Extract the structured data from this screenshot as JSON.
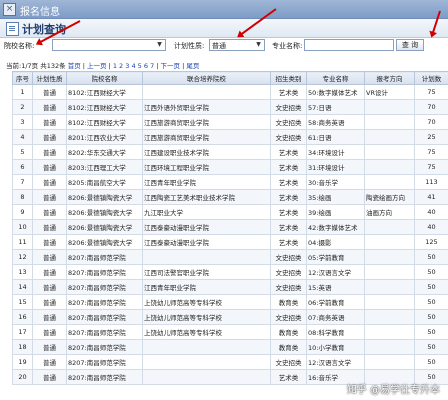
{
  "window": {
    "title": "报名信息",
    "close_glyph": "×"
  },
  "section": {
    "title": "计划查询"
  },
  "search": {
    "school_label": "院校名称:",
    "school_value": "",
    "plan_type_label": "计划性质:",
    "plan_type_value": "普通",
    "major_label": "专业名称:",
    "major_value": "",
    "query_button": "查 询"
  },
  "pager": {
    "summary": "当前:1/7页 共132条",
    "first": "首页",
    "prev": "上一页",
    "pages": "1 2 3 4 5 6 7",
    "next": "下一页",
    "last": "尾页"
  },
  "table": {
    "headers": [
      "序号",
      "计划性质",
      "院校名称",
      "联合培养院校",
      "招生类别",
      "专业名称",
      "报考方向",
      "计划数"
    ],
    "rows": [
      [
        "1",
        "普通",
        "8102:江西财经大学",
        "",
        "艺术类",
        "50:数字媒体艺术",
        "VR设计",
        "75"
      ],
      [
        "2",
        "普通",
        "8102:江西财经大学",
        "江西外语外贸职业学院",
        "文史招类",
        "57:日语",
        "",
        "70"
      ],
      [
        "3",
        "普通",
        "8102:江西财经大学",
        "江西旅游商贸职业学院",
        "文史招类",
        "58:商务英语",
        "",
        "70"
      ],
      [
        "4",
        "普通",
        "8201:江西农业大学",
        "江西旅游商贸职业学院",
        "文史招类",
        "61:日语",
        "",
        "25"
      ],
      [
        "5",
        "普通",
        "8202:华东交通大学",
        "江西建设职业技术学院",
        "艺术类",
        "34:环境设计",
        "",
        "75"
      ],
      [
        "6",
        "普通",
        "8203:江西理工大学",
        "江西环境工程职业学院",
        "艺术类",
        "31:环境设计",
        "",
        "75"
      ],
      [
        "7",
        "普通",
        "8205:南昌航空大学",
        "江西青年职业学院",
        "艺术类",
        "30:音乐学",
        "",
        "113"
      ],
      [
        "8",
        "普通",
        "8206:景德镇陶瓷大学",
        "江西陶瓷工艺美术职业技术学院",
        "艺术类",
        "35:绘画",
        "陶瓷绘画方向",
        "41"
      ],
      [
        "9",
        "普通",
        "8206:景德镇陶瓷大学",
        "九江职业大学",
        "艺术类",
        "39:绘画",
        "油画方向",
        "40"
      ],
      [
        "10",
        "普通",
        "8206:景德镇陶瓷大学",
        "江西泰豪动漫职业学院",
        "艺术类",
        "42:数字媒体艺术",
        "",
        "40"
      ],
      [
        "11",
        "普通",
        "8206:景德镇陶瓷大学",
        "江西泰豪动漫职业学院",
        "艺术类",
        "04:摄影",
        "",
        "125"
      ],
      [
        "12",
        "普通",
        "8207:南昌师范学院",
        "",
        "文史招类",
        "05:学前教育",
        "",
        "50"
      ],
      [
        "13",
        "普通",
        "8207:南昌师范学院",
        "江西司法警官职业学院",
        "文史招类",
        "12:汉语言文学",
        "",
        "50"
      ],
      [
        "14",
        "普通",
        "8207:南昌师范学院",
        "江西青年职业学院",
        "文史招类",
        "15:英语",
        "",
        "50"
      ],
      [
        "15",
        "普通",
        "8207:南昌师范学院",
        "上饶幼儿师范高等专科学校",
        "教育类",
        "06:学前教育",
        "",
        "50"
      ],
      [
        "16",
        "普通",
        "8207:南昌师范学院",
        "上饶幼儿师范高等专科学校",
        "文史招类",
        "07:商务英语",
        "",
        "50"
      ],
      [
        "17",
        "普通",
        "8207:南昌师范学院",
        "上饶幼儿师范高等专科学校",
        "教育类",
        "08:科学教育",
        "",
        "50"
      ],
      [
        "18",
        "普通",
        "8207:南昌师范学院",
        "",
        "教育类",
        "10:小学教育",
        "",
        "50"
      ],
      [
        "19",
        "普通",
        "8207:南昌师范学院",
        "",
        "文史招类",
        "12:汉语言文学",
        "",
        "50"
      ],
      [
        "20",
        "普通",
        "8207:南昌师范学院",
        "",
        "艺术类",
        "16:音乐学",
        "",
        "50"
      ]
    ]
  },
  "watermark": "知乎 @易学仕专升本",
  "colors": {
    "annotation_arrow": "#d10000",
    "title_bar": "#8aa6cf",
    "link": "#1a3fb0"
  }
}
